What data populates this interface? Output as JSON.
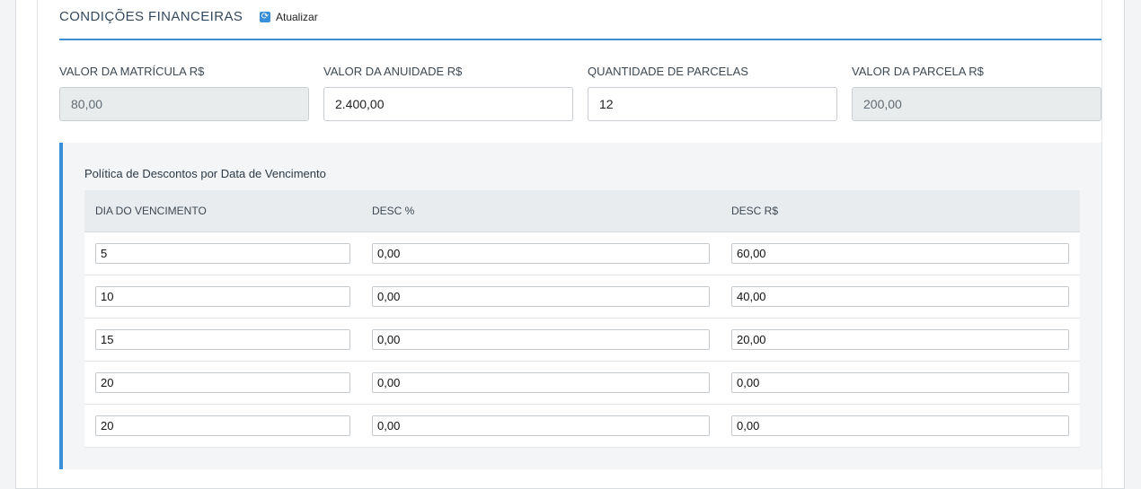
{
  "section": {
    "title": "CONDIÇÕES FINANCEIRAS",
    "refresh_label": "Atualizar",
    "refresh_icon": "refresh-icon"
  },
  "fields": [
    {
      "label": "VALOR DA MATRÍCULA R$",
      "value": "80,00",
      "readonly": true
    },
    {
      "label": "VALOR DA ANUIDADE R$",
      "value": "2.400,00",
      "readonly": false
    },
    {
      "label": "QUANTIDADE DE PARCELAS",
      "value": "12",
      "readonly": false
    },
    {
      "label": "VALOR DA PARCELA R$",
      "value": "200,00",
      "readonly": true
    }
  ],
  "discount_policy": {
    "title": "Política de Descontos por Data de Vencimento",
    "columns": [
      "DIA DO VENCIMENTO",
      "DESC %",
      "DESC R$"
    ],
    "rows": [
      [
        "5",
        "0,00",
        "60,00"
      ],
      [
        "10",
        "0,00",
        "40,00"
      ],
      [
        "15",
        "0,00",
        "20,00"
      ],
      [
        "20",
        "0,00",
        "0,00"
      ],
      [
        "20",
        "0,00",
        "0,00"
      ]
    ]
  },
  "colors": {
    "accent": "#3a8fd8",
    "rule": "#3f8fd0",
    "readonly_bg": "#e9eced"
  }
}
